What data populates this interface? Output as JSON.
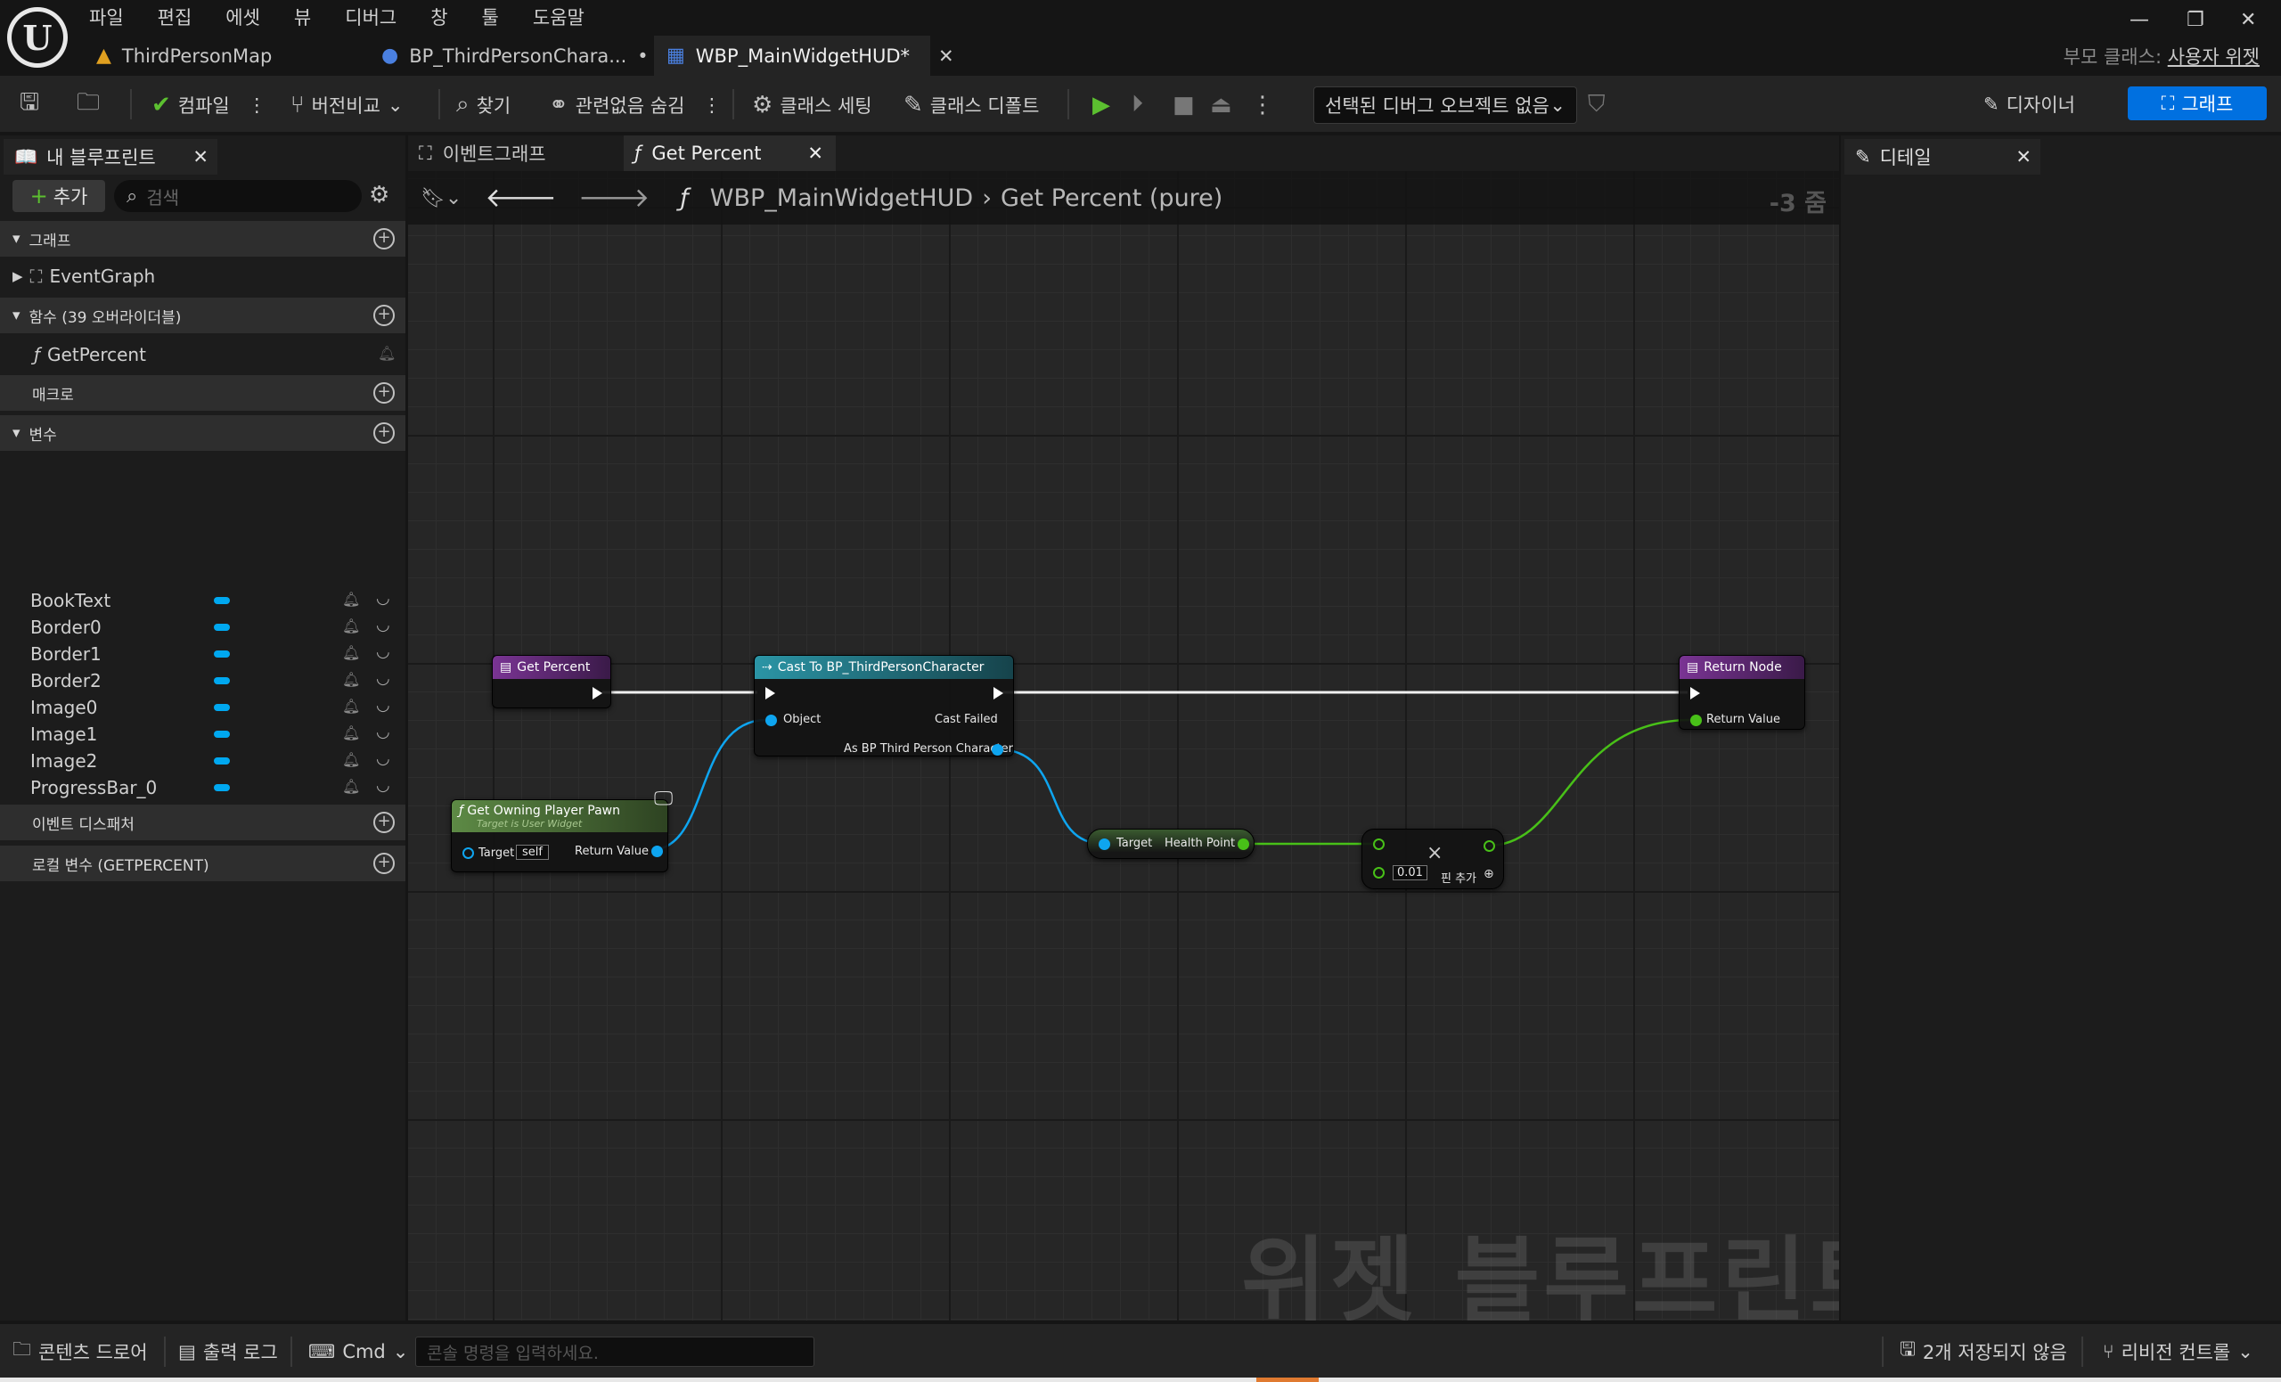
{
  "app": {
    "menu": [
      "파일",
      "편집",
      "에셋",
      "뷰",
      "디버그",
      "창",
      "툴",
      "도움말"
    ],
    "doc_tabs": [
      {
        "label": "ThirdPersonMap",
        "icon": "level-map-icon",
        "modified": ""
      },
      {
        "label": "BP_ThirdPersonChara...",
        "icon": "blueprint-character-icon",
        "modified": "•"
      },
      {
        "label": "WBP_MainWidgetHUD*",
        "icon": "widget-blueprint-icon",
        "modified": ""
      }
    ],
    "parent_class_label": "부모 클래스:",
    "parent_class_value": "사용자 위젯"
  },
  "toolbar": {
    "compile": "컴파일",
    "diff": "버전비교",
    "find": "찾기",
    "hide_unrelated": "관련없음 숨김",
    "class_settings": "클래스 세팅",
    "class_defaults": "클래스 디폴트",
    "debug_object": "선택된 디버그 오브젝트 없음",
    "mode_designer": "디자이너",
    "mode_graph": "그래프"
  },
  "left_panel": {
    "tab": "내 블루프린트",
    "add": "추가",
    "search_placeholder": "검색",
    "sections": {
      "graphs": "그래프",
      "functions": "함수 (39 오버라이더블)",
      "macros": "매크로",
      "variables": "변수",
      "event_dispatchers": "이벤트 디스패처",
      "local_vars": "로컬 변수 (GETPERCENT)"
    },
    "graph_items": [
      "EventGraph"
    ],
    "function_items": [
      "GetPercent"
    ],
    "variables": [
      "BookText",
      "Border0",
      "Border1",
      "Border2",
      "Image0",
      "Image1",
      "Image2",
      "ProgressBar_0"
    ]
  },
  "center": {
    "tabs": [
      "이벤트그래프",
      "Get Percent"
    ],
    "breadcrumb_root": "WBP_MainWidgetHUD",
    "breadcrumb_leaf": "Get Percent (pure)",
    "zoom": "-3 줌",
    "watermark": "위젯 블루프린트",
    "nodes": {
      "entry": {
        "title": "Get Percent"
      },
      "cast": {
        "title": "Cast To BP_ThirdPersonCharacter",
        "pin_object": "Object",
        "pin_failed": "Cast Failed",
        "pin_as": "As BP Third Person Character"
      },
      "owner": {
        "title": "Get Owning Player Pawn",
        "subtitle": "Target is User Widget",
        "pin_target": "Target",
        "target_value": "self",
        "pin_return": "Return Value"
      },
      "health": {
        "pin_target": "Target",
        "pin_health": "Health Point"
      },
      "multiply": {
        "symbol": "×",
        "value": "0.01",
        "add_pin": "핀 추가"
      },
      "return": {
        "title": "Return Node",
        "pin_return": "Return Value"
      }
    }
  },
  "right_panel": {
    "tab": "디테일"
  },
  "statusbar": {
    "content_drawer": "콘텐츠 드로어",
    "output_log": "출력 로그",
    "cmd": "Cmd",
    "console_placeholder": "콘솔 명령을 입력하세요.",
    "unsaved": "2개 저장되지 않음",
    "revision_control": "리비전 컨트롤"
  },
  "colors": {
    "accent": "#0070e0",
    "function_header": "#6a2e80",
    "cast_header": "#2a8a9a",
    "pure_header": "#4f7a3a",
    "object_pin": "#0ea5f0",
    "float_pin": "#48c018"
  }
}
